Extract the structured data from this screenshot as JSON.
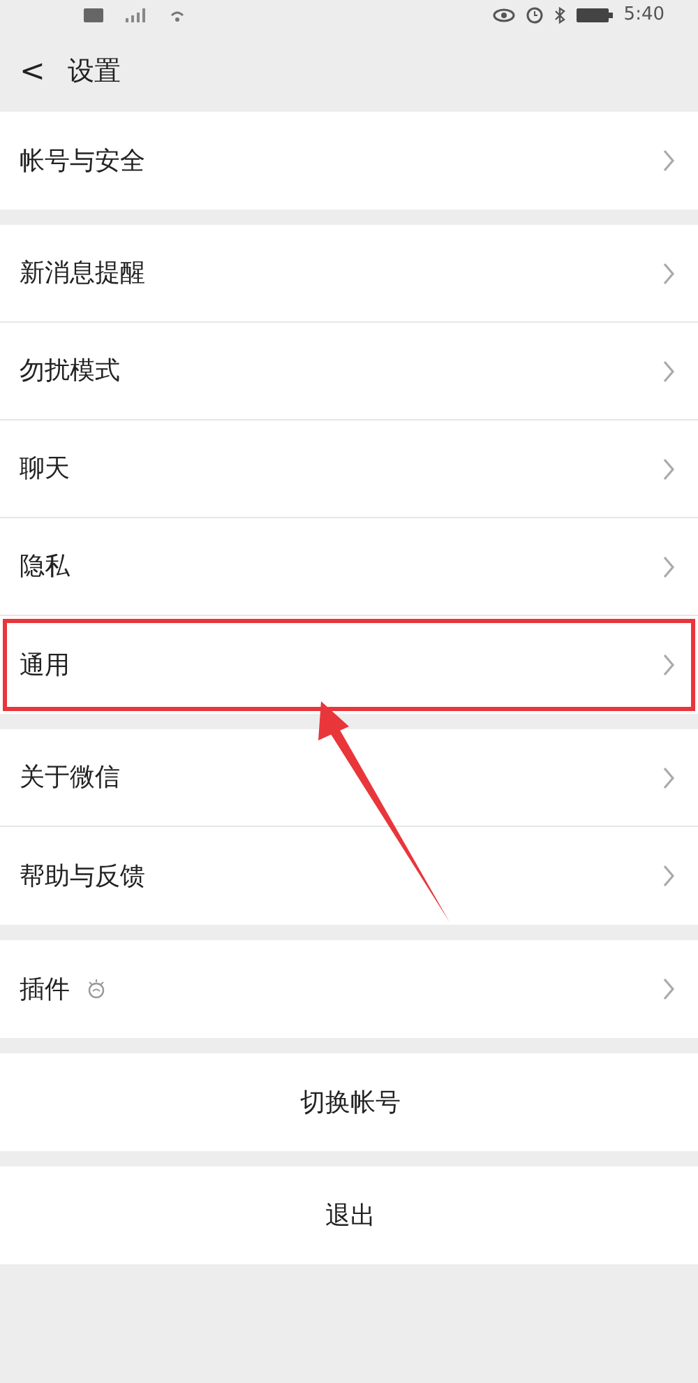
{
  "status_bar": {
    "time": "5:40"
  },
  "header": {
    "back": "<",
    "title": "设置"
  },
  "groups": [
    {
      "items": [
        {
          "kind": "nav",
          "label": "帐号与安全",
          "highlighted": false,
          "icon": false
        }
      ]
    },
    {
      "items": [
        {
          "kind": "nav",
          "label": "新消息提醒",
          "highlighted": false,
          "icon": false
        },
        {
          "kind": "nav",
          "label": "勿扰模式",
          "highlighted": false,
          "icon": false
        },
        {
          "kind": "nav",
          "label": "聊天",
          "highlighted": false,
          "icon": false
        },
        {
          "kind": "nav",
          "label": "隐私",
          "highlighted": false,
          "icon": false
        },
        {
          "kind": "nav",
          "label": "通用",
          "highlighted": true,
          "icon": false
        }
      ]
    },
    {
      "items": [
        {
          "kind": "nav",
          "label": "关于微信",
          "highlighted": false,
          "icon": false
        },
        {
          "kind": "nav",
          "label": "帮助与反馈",
          "highlighted": false,
          "icon": false
        }
      ]
    },
    {
      "items": [
        {
          "kind": "nav",
          "label": "插件",
          "highlighted": false,
          "icon": true
        }
      ]
    },
    {
      "items": [
        {
          "kind": "action",
          "label": "切换帐号",
          "highlighted": false
        }
      ]
    },
    {
      "items": [
        {
          "kind": "action",
          "label": "退出",
          "highlighted": false
        }
      ]
    }
  ]
}
